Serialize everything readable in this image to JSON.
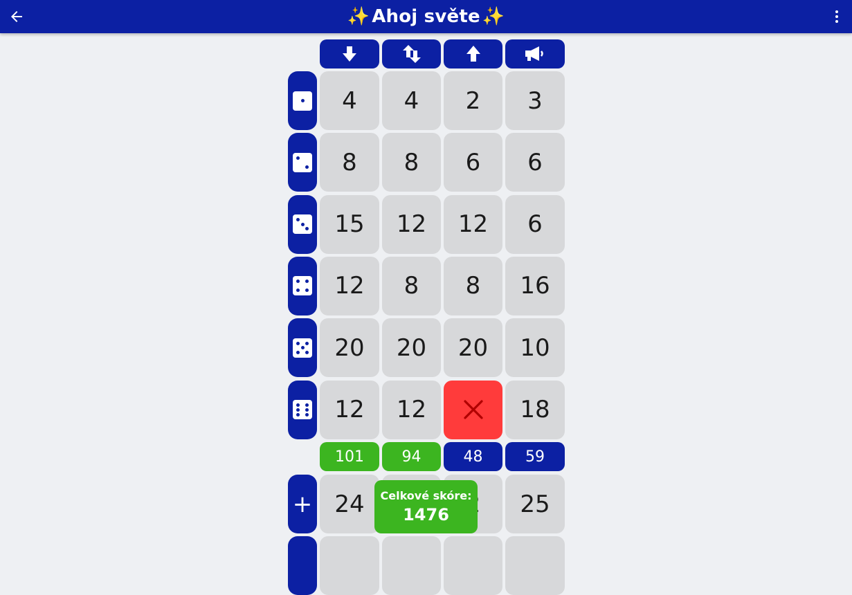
{
  "app_bar": {
    "title": "Ahoj světe",
    "spark_left": "✨",
    "spark_right": "✨"
  },
  "columns": [
    {
      "icon": "arrow-down-icon"
    },
    {
      "icon": "arrows-up-down-icon"
    },
    {
      "icon": "arrow-up-icon"
    },
    {
      "icon": "megaphone-icon"
    }
  ],
  "rows": [
    {
      "die": 1,
      "values": [
        "4",
        "4",
        "2",
        "3"
      ]
    },
    {
      "die": 2,
      "values": [
        "8",
        "8",
        "6",
        "6"
      ]
    },
    {
      "die": 3,
      "values": [
        "15",
        "12",
        "12",
        "6"
      ]
    },
    {
      "die": 4,
      "values": [
        "12",
        "8",
        "8",
        "16"
      ]
    },
    {
      "die": 5,
      "values": [
        "20",
        "20",
        "20",
        "10"
      ]
    },
    {
      "die": 6,
      "values": [
        "12",
        "12",
        "",
        "18"
      ]
    }
  ],
  "crossed_cell": {
    "row": 5,
    "col": 2
  },
  "subtotals": [
    {
      "value": "101",
      "color": "#3cb520"
    },
    {
      "value": "94",
      "color": "#3cb520"
    },
    {
      "value": "48",
      "color": "#0c20a3"
    },
    {
      "value": "59",
      "color": "#0c20a3"
    }
  ],
  "bonus_row": {
    "label": "+",
    "values": [
      "24",
      "",
      "2",
      "25"
    ]
  },
  "total": {
    "label": "Celkové skóre:",
    "value": "1476"
  },
  "colors": {
    "primary": "#0c20a3",
    "success": "#3cb520",
    "danger": "#ff3b3b",
    "cell": "#d7d8da"
  }
}
